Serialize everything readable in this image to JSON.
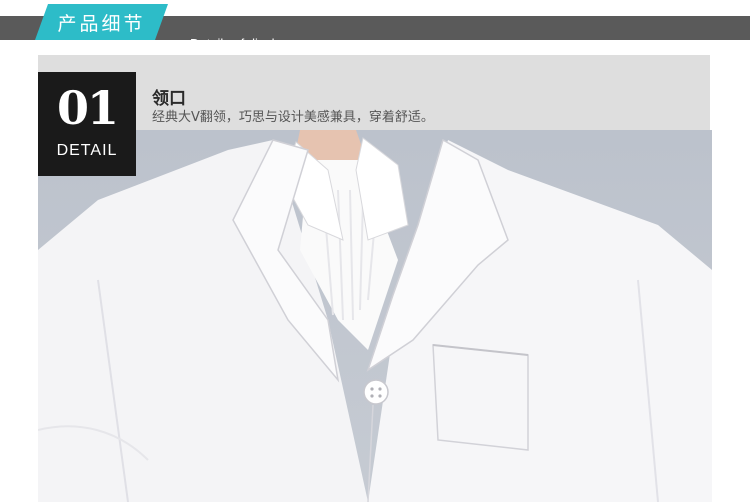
{
  "header": {
    "tab_label": "产品细节",
    "subtitle": "Details of display",
    "tab_color": "#2dbcc8",
    "bar_color": "#5a5a5a"
  },
  "detail": {
    "number": "01",
    "label": "DETAIL",
    "title": "领口",
    "description": "经典大V翻领，巧思与设计美感兼具，穿着舒适。"
  },
  "photo": {
    "subject": "white-lab-coat-collar"
  }
}
